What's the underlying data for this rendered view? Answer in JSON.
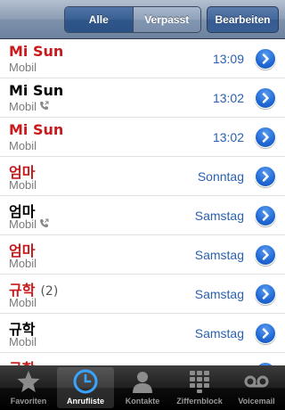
{
  "nav": {
    "segment_all": "Alle",
    "segment_missed": "Verpasst",
    "edit_label": "Bearbeiten"
  },
  "calls": [
    {
      "name": "Mi Sun",
      "count": "",
      "type": "Mobil",
      "time": "13:09",
      "missed": true,
      "outgoing": false
    },
    {
      "name": "Mi Sun",
      "count": "",
      "type": "Mobil",
      "time": "13:02",
      "missed": false,
      "outgoing": true
    },
    {
      "name": "Mi Sun",
      "count": "",
      "type": "Mobil",
      "time": "13:02",
      "missed": true,
      "outgoing": false
    },
    {
      "name": "엄마",
      "count": "",
      "type": "Mobil",
      "time": "Sonntag",
      "missed": true,
      "outgoing": false
    },
    {
      "name": "엄마",
      "count": "",
      "type": "Mobil",
      "time": "Samstag",
      "missed": false,
      "outgoing": true
    },
    {
      "name": "엄마",
      "count": "",
      "type": "Mobil",
      "time": "Samstag",
      "missed": true,
      "outgoing": false
    },
    {
      "name": "규학",
      "count": "(2)",
      "type": "Mobil",
      "time": "Samstag",
      "missed": true,
      "outgoing": false
    },
    {
      "name": "규학",
      "count": "",
      "type": "Mobil",
      "time": "Samstag",
      "missed": false,
      "outgoing": false
    },
    {
      "name": "규학",
      "count": "",
      "type": "",
      "time": "",
      "missed": true,
      "outgoing": false
    }
  ],
  "tabs": [
    {
      "label": "Favoriten",
      "icon": "star-icon",
      "active": false
    },
    {
      "label": "Anrufliste",
      "icon": "clock-icon",
      "active": true
    },
    {
      "label": "Kontakte",
      "icon": "contact-icon",
      "active": false
    },
    {
      "label": "Ziffernblock",
      "icon": "keypad-icon",
      "active": false
    },
    {
      "label": "Voicemail",
      "icon": "voicemail-icon",
      "active": false
    }
  ],
  "colors": {
    "missed": "#c8191c",
    "accent": "#2a5fb0"
  }
}
